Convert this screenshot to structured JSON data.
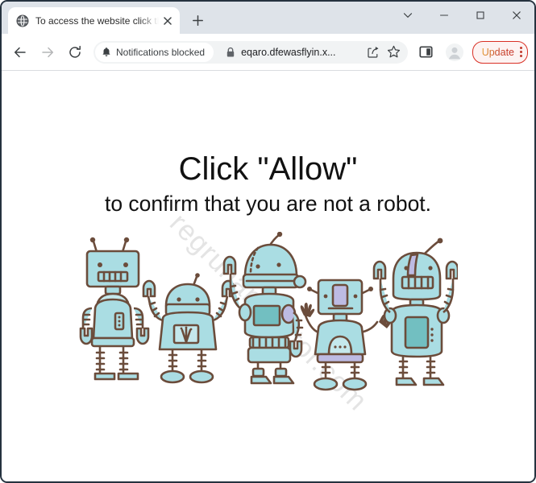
{
  "window": {
    "controls": [
      {
        "name": "tab-search",
        "icon": "chevron-down-icon",
        "tooltip": "Search tabs"
      },
      {
        "name": "minimize",
        "icon": "minimize-icon",
        "tooltip": "Minimize"
      },
      {
        "name": "maximize",
        "icon": "maximize-icon",
        "tooltip": "Maximize"
      },
      {
        "name": "close",
        "icon": "close-icon",
        "tooltip": "Close"
      }
    ]
  },
  "tab_strip": {
    "tabs": [
      {
        "title": "To access the website click the \"A",
        "favicon": "globe-icon",
        "close_label": "×",
        "active": true
      }
    ],
    "new_tab_label": "+"
  },
  "toolbar": {
    "back_label": "←",
    "forward_label": "→",
    "reload_label": "↻",
    "notifications_chip": {
      "icon": "bell-blocked-icon",
      "label": "Notifications blocked"
    },
    "site_security_icon": "lock-icon",
    "url": "eqaro.dfewasflyin.x...",
    "share_icon": "share-icon",
    "bookmark_icon": "star-icon",
    "side_panel_icon": "side-panel-icon",
    "profile_icon": "avatar-icon",
    "update_label": "Update",
    "update_menu_icon": "three-dots-icon"
  },
  "page": {
    "headline": "Click \"Allow\"",
    "subheadline": "to confirm that you are not a robot.",
    "watermark": "regrunanimator.com",
    "illustration_alt": "five-cartoon-robots"
  },
  "colors": {
    "frame_border": "#25323f",
    "tab_strip_bg": "#dee3e9",
    "toolbar_bg": "#ffffff",
    "omnibox_bg": "#f1f3f4",
    "update_accent": "#d93025",
    "robot_body": "#a8dce2",
    "robot_outline": "#6b4c3b",
    "robot_accent": "#b9b7e0",
    "robot_screen": "#7cc3c4"
  }
}
